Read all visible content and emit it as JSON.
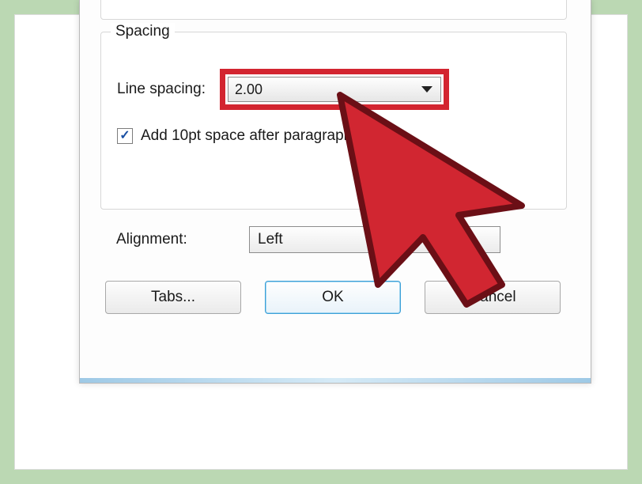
{
  "spacing": {
    "group_label": "Spacing",
    "line_spacing_label": "Line spacing:",
    "line_spacing_value": "2.00",
    "checkbox_checked": true,
    "checkbox_label": "Add 10pt space after paragraph"
  },
  "alignment": {
    "label": "Alignment:",
    "value": "Left"
  },
  "buttons": {
    "tabs": "Tabs...",
    "ok": "OK",
    "cancel": "Cancel"
  },
  "colors": {
    "highlight": "#d32530",
    "ok_border": "#3ca0d8"
  }
}
